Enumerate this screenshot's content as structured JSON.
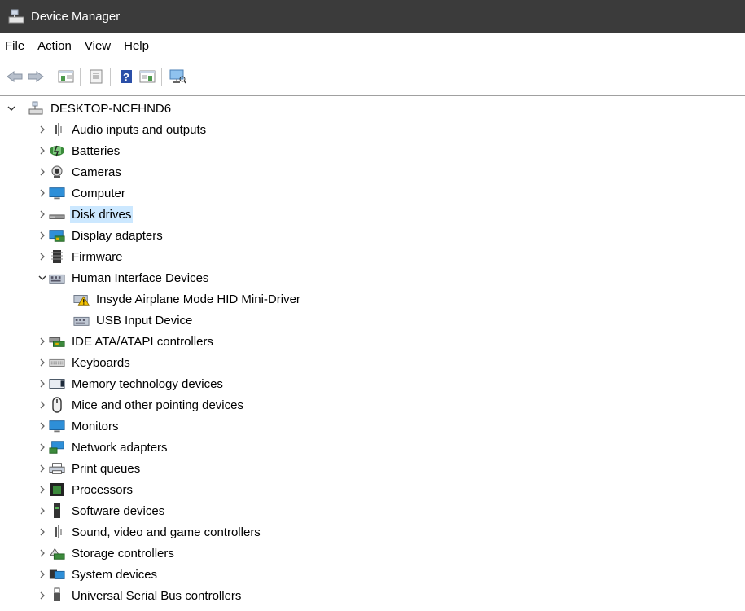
{
  "window": {
    "title": "Device Manager"
  },
  "menu": {
    "file": "File",
    "action": "Action",
    "view": "View",
    "help": "Help"
  },
  "toolbar": {
    "buttons": [
      "back-icon",
      "forward-icon",
      "properties-pane-icon",
      "properties-icon",
      "help-icon",
      "show-hidden-icon",
      "scan-hardware-icon"
    ]
  },
  "tree": {
    "root": "DESKTOP-NCFHND6",
    "categories": [
      "Audio inputs and outputs",
      "Batteries",
      "Cameras",
      "Computer",
      "Disk drives",
      "Display adapters",
      "Firmware",
      "Human Interface Devices",
      "IDE ATA/ATAPI controllers",
      "Keyboards",
      "Memory technology devices",
      "Mice and other pointing devices",
      "Monitors",
      "Network adapters",
      "Print queues",
      "Processors",
      "Software devices",
      "Sound, video and game controllers",
      "Storage controllers",
      "System devices",
      "Universal Serial Bus controllers"
    ],
    "hid_children": [
      "Insyde Airplane Mode HID Mini-Driver",
      "USB Input Device"
    ],
    "selected": "Disk drives",
    "expanded": "Human Interface Devices"
  },
  "colors": {
    "titlebar": "#3b3b3b",
    "selection": "#cce8ff"
  }
}
